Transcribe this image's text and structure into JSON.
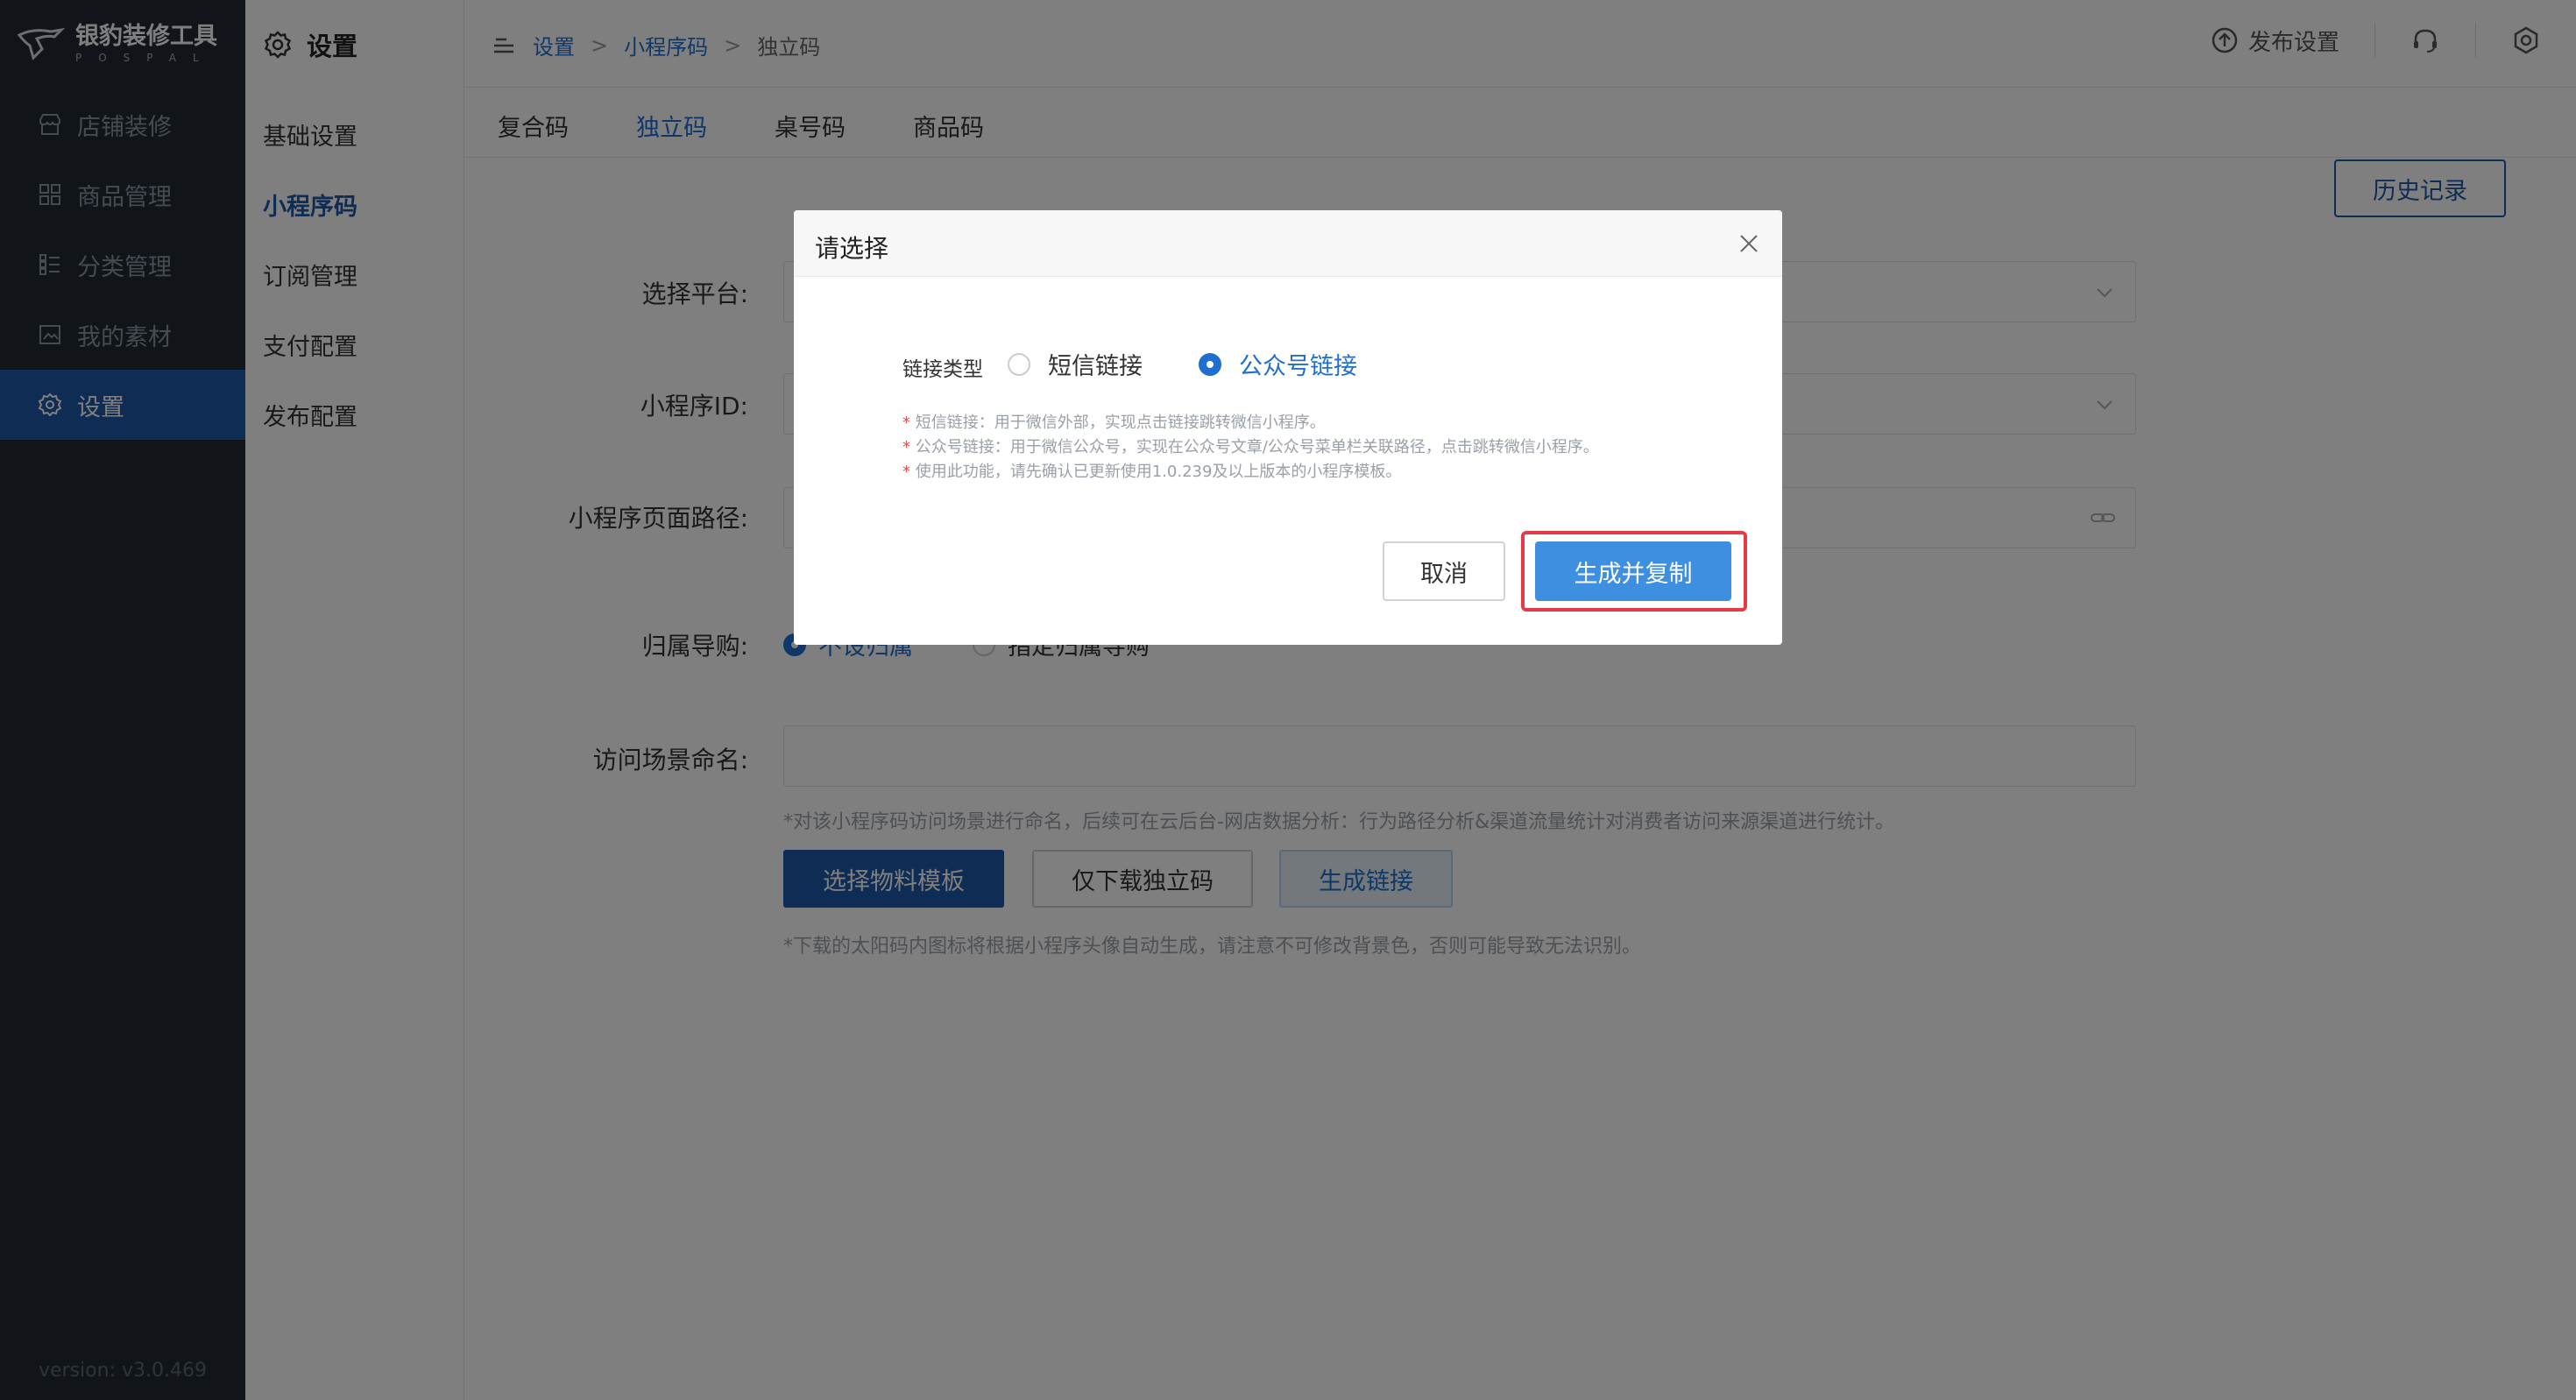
{
  "app": {
    "logo_title": "银豹装修工具",
    "logo_sub": "POSPAL",
    "version": "version: v3.0.469"
  },
  "nav": {
    "items": [
      {
        "label": "店铺装修",
        "icon": "store-icon"
      },
      {
        "label": "商品管理",
        "icon": "grid-icon"
      },
      {
        "label": "分类管理",
        "icon": "list-icon"
      },
      {
        "label": "我的素材",
        "icon": "image-icon"
      },
      {
        "label": "设置",
        "icon": "gear-icon",
        "active": true
      }
    ]
  },
  "subnav": {
    "title": "设置",
    "items": [
      {
        "label": "基础设置"
      },
      {
        "label": "小程序码",
        "active": true
      },
      {
        "label": "订阅管理"
      },
      {
        "label": "支付配置"
      },
      {
        "label": "发布配置"
      }
    ]
  },
  "breadcrumb": {
    "items": [
      "设置",
      "小程序码",
      "独立码"
    ],
    "sep": ">"
  },
  "topbar": {
    "publish": "发布设置"
  },
  "tabs": [
    {
      "label": "复合码"
    },
    {
      "label": "独立码",
      "active": true
    },
    {
      "label": "桌号码"
    },
    {
      "label": "商品码"
    }
  ],
  "page": {
    "history_button": "历史记录",
    "labels": {
      "platform": "选择平台:",
      "appid": "小程序ID:",
      "path": "小程序页面路径:",
      "guide": "归属导购:",
      "scene": "访问场景命名:"
    },
    "guide_options": [
      "不设归属",
      "指定归属导购"
    ],
    "scene_hint": "*对该小程序码访问场景进行命名，后续可在云后台-网店数据分析：行为路径分析&渠道流量统计对消费者访问来源渠道进行统计。",
    "buttons": {
      "template": "选择物料模板",
      "download": "仅下载独立码",
      "link": "生成链接"
    },
    "bottom_hint": "*下载的太阳码内图标将根据小程序头像自动生成，请注意不可修改背景色，否则可能导致无法识别。"
  },
  "modal": {
    "title": "请选择",
    "type_label": "链接类型",
    "options": [
      {
        "label": "短信链接",
        "selected": false
      },
      {
        "label": "公众号链接",
        "selected": true
      }
    ],
    "notes": [
      "短信链接：用于微信外部，实现点击链接跳转微信小程序。",
      "公众号链接：用于微信公众号，实现在公众号文章/公众号菜单栏关联路径，点击跳转微信小程序。",
      "使用此功能，请先确认已更新使用1.0.239及以上版本的小程序模板。"
    ],
    "note_marker": "*",
    "cancel": "取消",
    "confirm": "生成并复制"
  },
  "colors": {
    "primary": "#1e5aa8",
    "accent": "#1e6fd0",
    "highlight": "#e53b49",
    "sidebar": "#222a35"
  }
}
